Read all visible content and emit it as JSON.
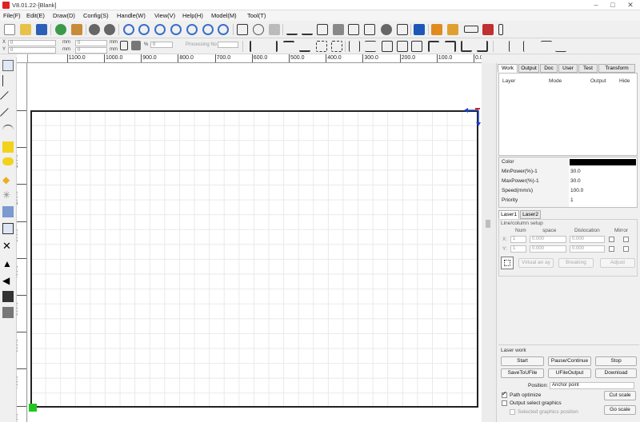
{
  "window": {
    "title": "V8.01.22-[Blank]"
  },
  "menu": [
    "File(F)",
    "Edit(E)",
    "Draw(D)",
    "Config(S)",
    "Handle(W)",
    "View(V)",
    "Help(H)",
    "Model(M)",
    "Tool(T)"
  ],
  "toolbar2": {
    "x_value": "0",
    "y_value": "0",
    "w_value": "0",
    "h_value": "0",
    "unit": "mm",
    "ratio_value": "0",
    "ratio_label": "Processing No"
  },
  "rulers": {
    "h_labels": [
      "1100.0",
      "1000.0",
      "900.0",
      "800.0",
      "700.0",
      "600.0",
      "500.0",
      "400.0",
      "300.0",
      "200.0",
      "100.0",
      "0.0"
    ],
    "v_labels": [
      "0.0",
      "100.0",
      "200.0",
      "300.0",
      "400.0",
      "500.0",
      "600.0",
      "700.0",
      "800.0"
    ]
  },
  "panel": {
    "tabs": [
      "Work",
      "Output",
      "Doc",
      "User",
      "Test",
      "Transform"
    ],
    "layer_headers": [
      "Layer",
      "Mode",
      "Output",
      "Hide"
    ],
    "props": [
      {
        "label": "Color",
        "value": ""
      },
      {
        "label": "MinPower(%)-1",
        "value": "30.0"
      },
      {
        "label": "MaxPower(%)-1",
        "value": "30.0"
      },
      {
        "label": "Speed(mm/s)",
        "value": "100.0"
      },
      {
        "label": "Priority",
        "value": "1"
      }
    ],
    "color_value": "#000000",
    "laser_tabs": [
      "Laser1",
      "Laser2"
    ],
    "array": {
      "title": "Line/column setup",
      "headers": [
        "Num",
        "space",
        "Dislocation",
        "Mirror"
      ],
      "rows": [
        {
          "axis": "X:",
          "num": "1",
          "space": "0.000",
          "disloc": "0.000"
        },
        {
          "axis": "Y:",
          "num": "1",
          "space": "0.000",
          "disloc": "0.000"
        }
      ],
      "buttons": [
        "Virtual an ay",
        "Breaking",
        "Adjust"
      ]
    },
    "laser_work": {
      "title": "Laser work",
      "buttons_row1": [
        "Start",
        "Pause/Continue",
        "Stop"
      ],
      "buttons_row2": [
        "SaveToUFile",
        "UFileOutput",
        "Download"
      ],
      "position_label": "Position:",
      "position_value": "Anchor point",
      "path_optimize": "Path optimize",
      "output_select": "Output select graphics",
      "selected_position": "Selected graphics position",
      "cut_scale": "Cut scale",
      "go_scale": "Go scale"
    }
  },
  "colors": {
    "workarea_border": "#222222",
    "anchor": "#1ec81e",
    "accent_blue": "#1a3fd0",
    "accent_red": "#d22222"
  }
}
